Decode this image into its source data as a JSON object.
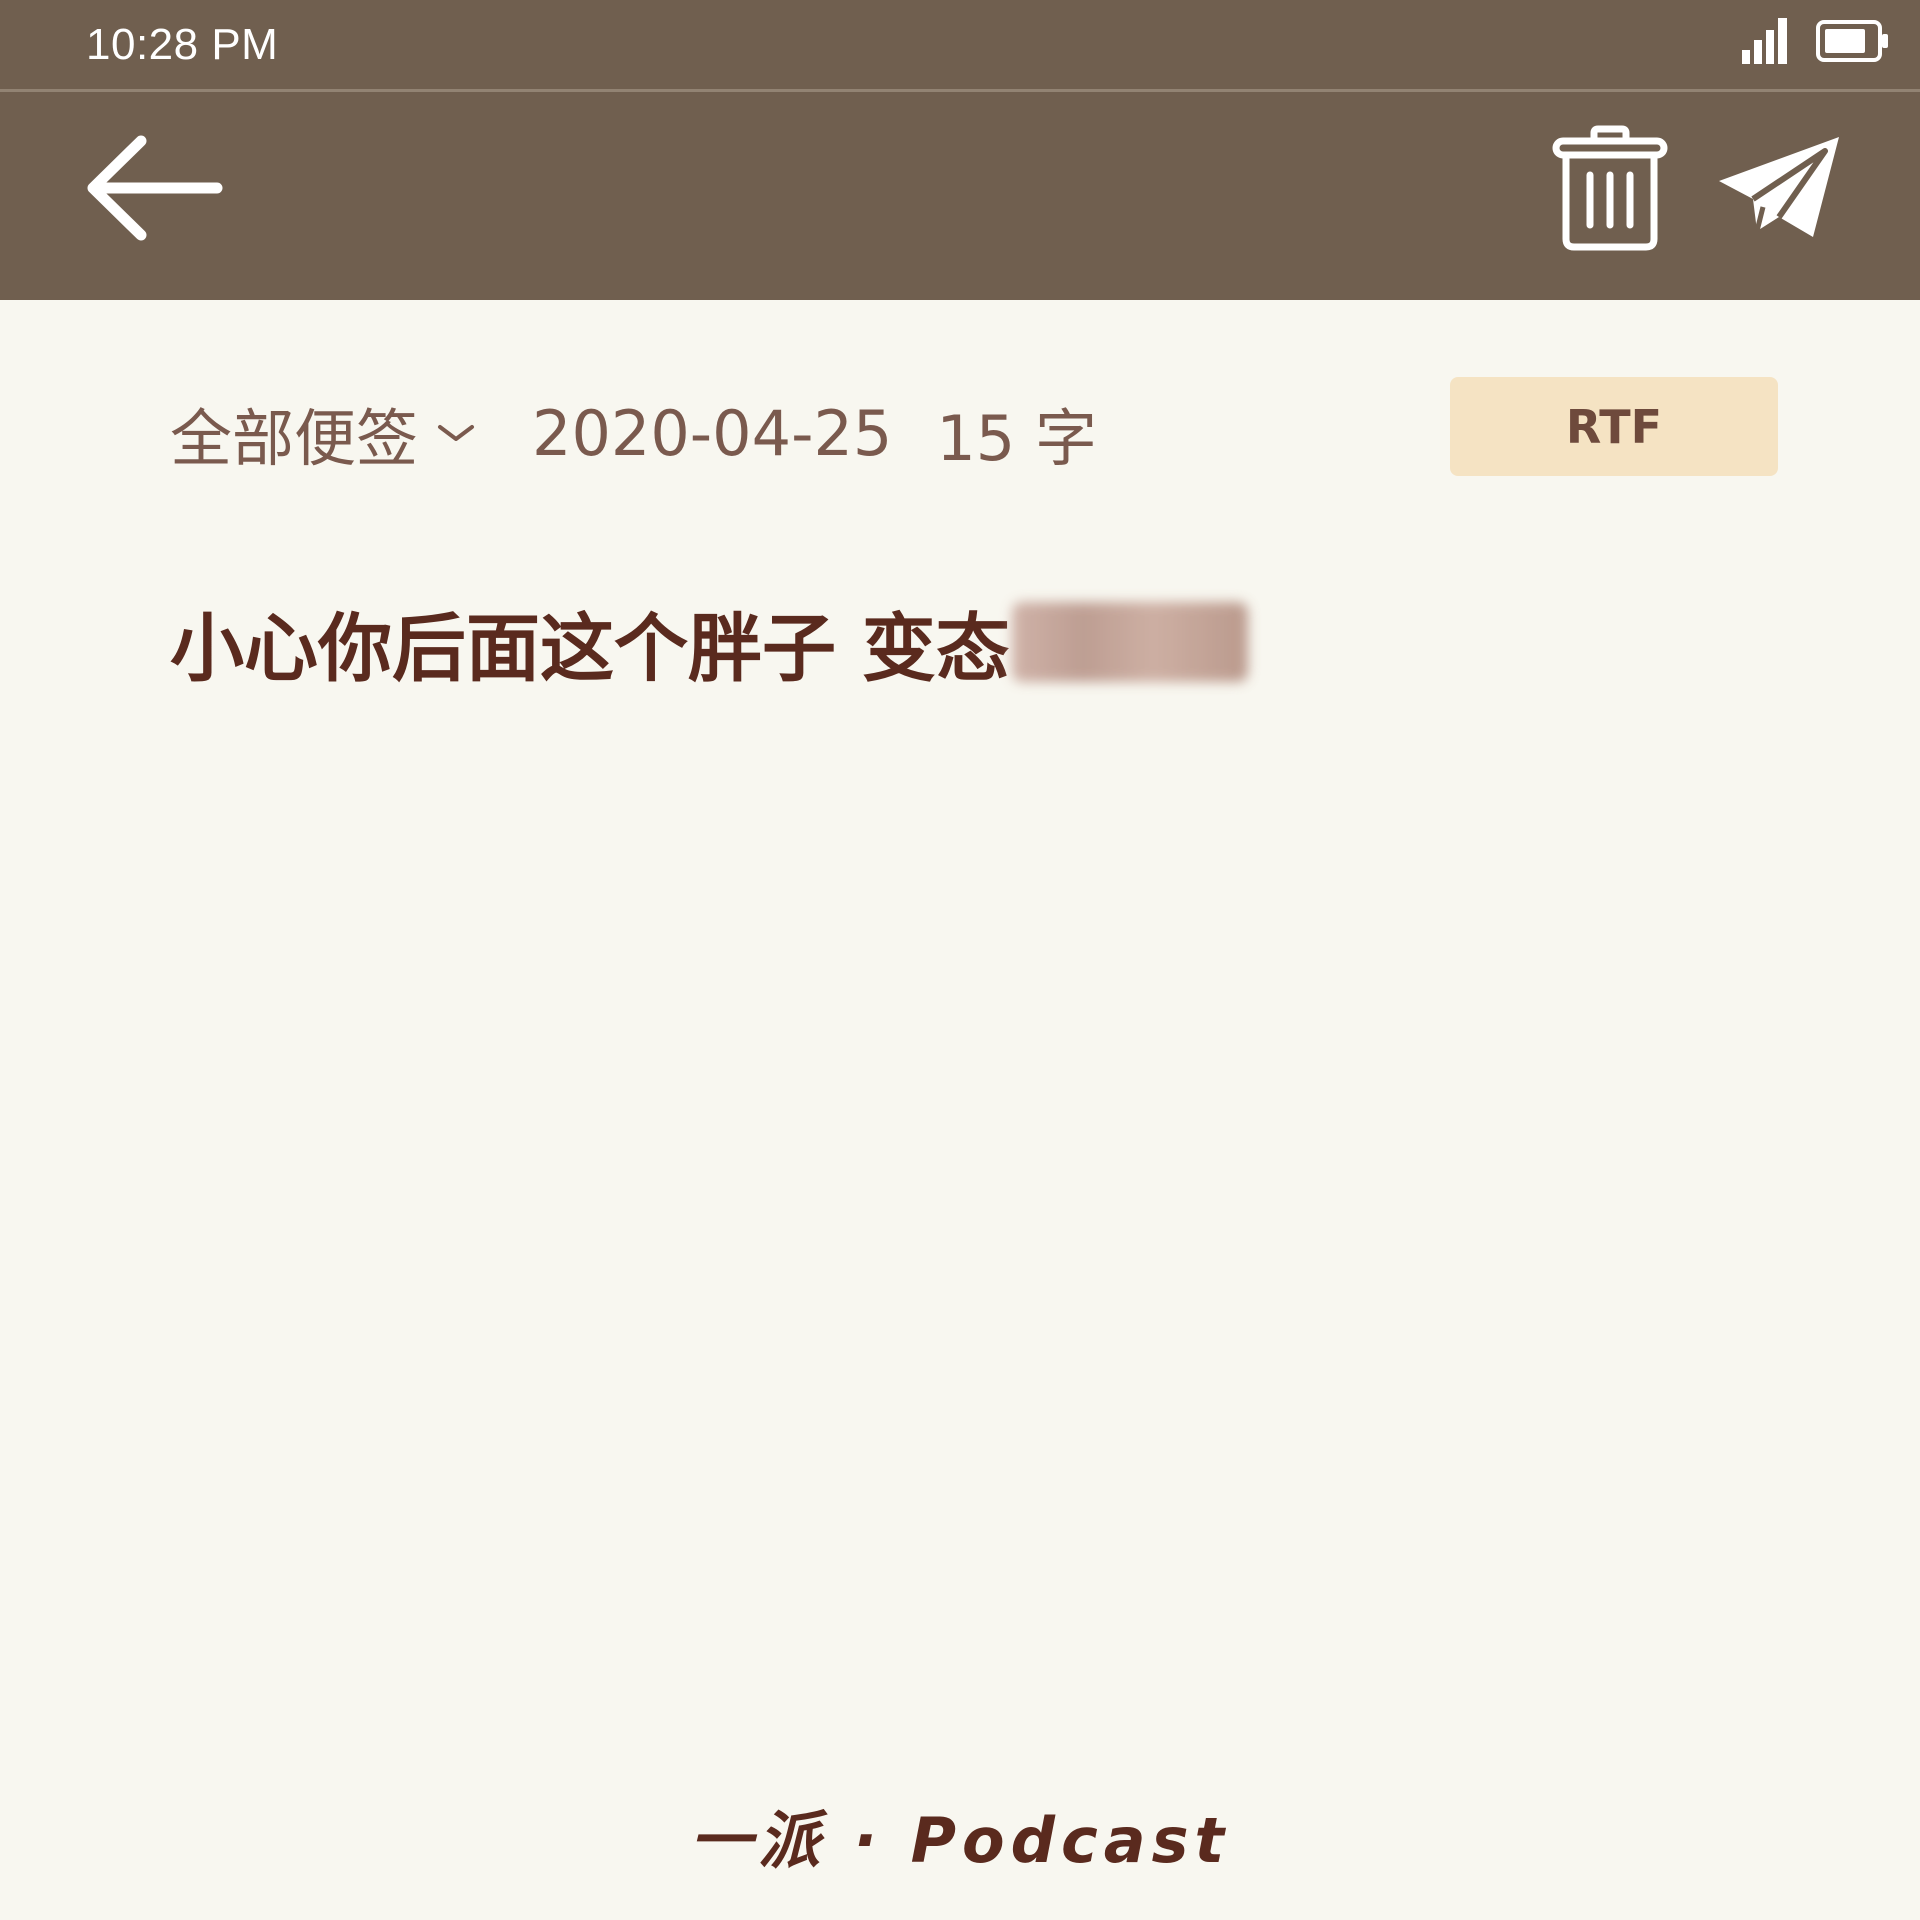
{
  "status_bar": {
    "time": "10:28 PM",
    "signal_icon": "signal-bars-icon",
    "battery_icon": "battery-icon"
  },
  "toolbar": {
    "back_icon": "arrow-left-icon",
    "delete_icon": "trash-icon",
    "send_icon": "paper-plane-icon"
  },
  "note": {
    "folder": "全部便签",
    "date": "2020-04-25",
    "word_count": "15 字",
    "format_button": "RTF",
    "content": "小心你后面这个胖子 变态"
  },
  "footer": {
    "brand": "一派 · Podcast"
  },
  "colors": {
    "header_bg": "#705f4f",
    "page_bg": "#f8f7f0",
    "meta_text": "#7a5a4e",
    "body_text": "#5a2a1e",
    "rtf_bg": "#f5e3c3"
  }
}
